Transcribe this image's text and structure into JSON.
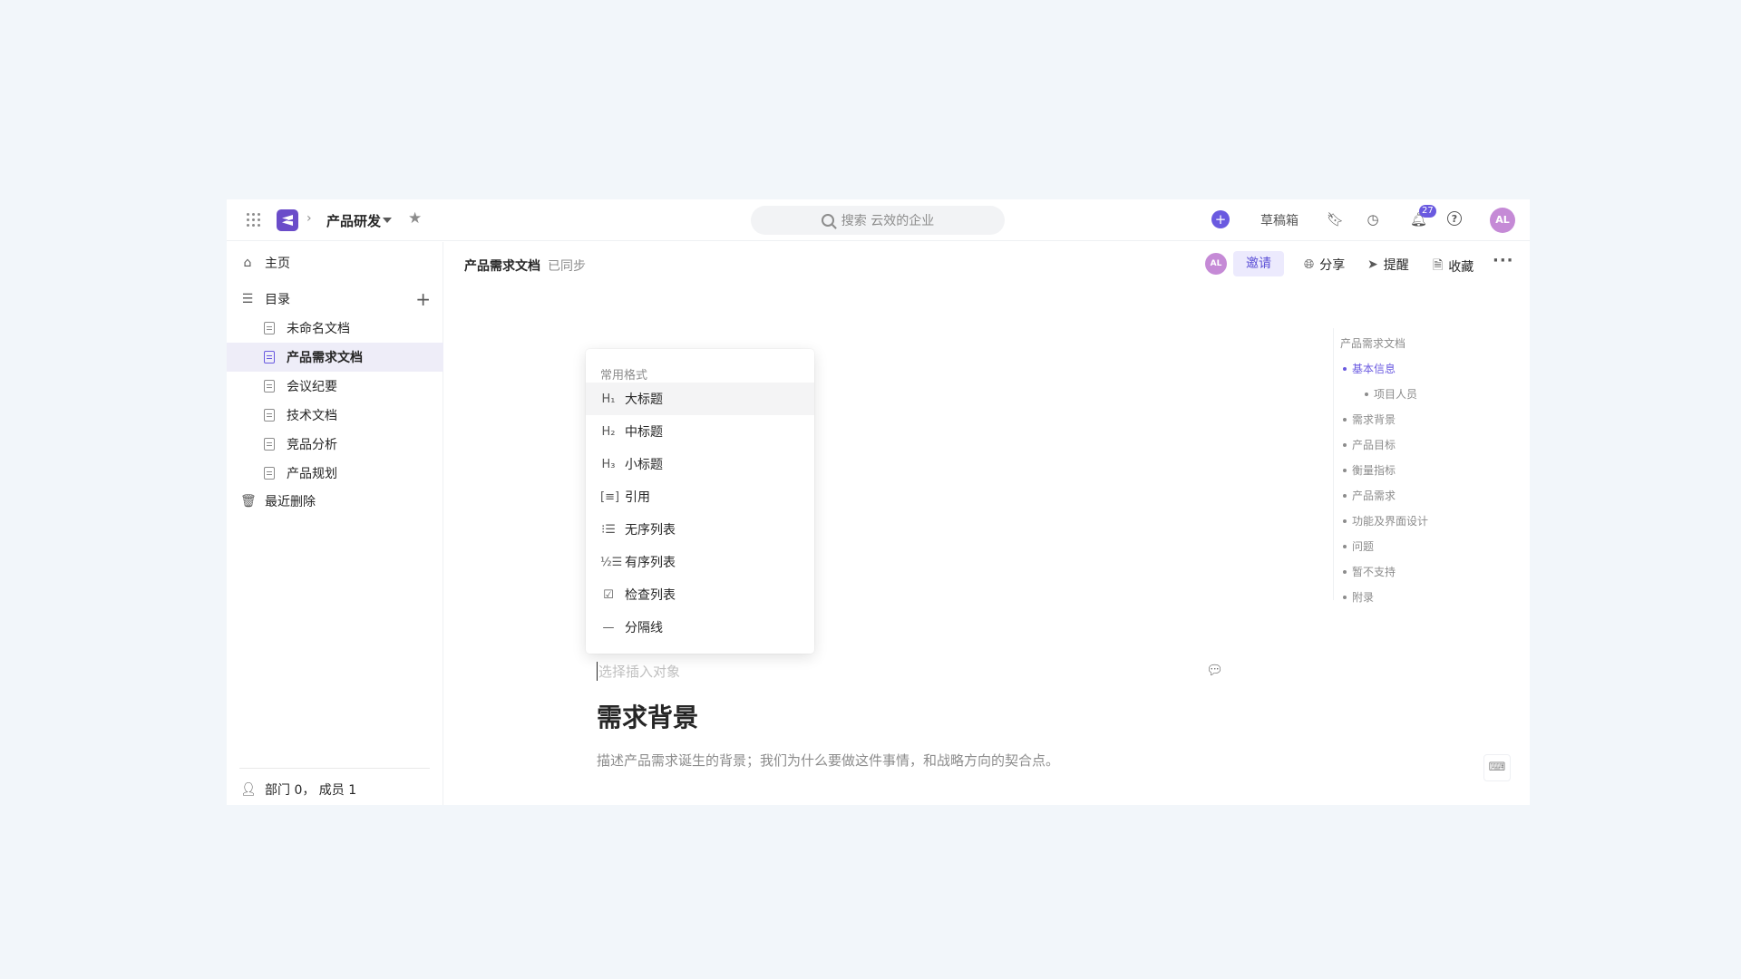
{
  "topbar": {
    "space_name": "产品研发",
    "search_placeholder": "搜索 云效的企业",
    "drafts_label": "草稿箱",
    "notification_count": "27",
    "avatar_initials": "AL",
    "colors": {
      "brand": "#6a4cc9",
      "accent": "#6a5ae0",
      "avatar": "#c58ad6"
    }
  },
  "sidebar": {
    "home_label": "主页",
    "catalog_label": "目录",
    "docs": [
      {
        "label": "未命名文档"
      },
      {
        "label": "产品需求文档"
      },
      {
        "label": "会议纪要"
      },
      {
        "label": "技术文档"
      },
      {
        "label": "竞品分析"
      },
      {
        "label": "产品规划"
      }
    ],
    "trash_label": "最近删除",
    "members_label": "部门 0， 成员 1"
  },
  "doc_header": {
    "title": "产品需求文档",
    "status": "已同步",
    "avatar_initials": "AL",
    "invite_label": "邀请",
    "share_label": "分享",
    "remind_label": "提醒",
    "favorite_label": "收藏"
  },
  "format_menu": {
    "title": "常用格式",
    "items": [
      {
        "icon": "H₁",
        "label": "大标题"
      },
      {
        "icon": "H₂",
        "label": "中标题"
      },
      {
        "icon": "H₃",
        "label": "小标题"
      },
      {
        "icon": "[≡]",
        "label": "引用"
      },
      {
        "icon": "⁝☰",
        "label": "无序列表"
      },
      {
        "icon": "½☰",
        "label": "有序列表"
      },
      {
        "icon": "☑",
        "label": "检查列表"
      },
      {
        "icon": "—",
        "label": "分隔线"
      }
    ]
  },
  "editor": {
    "insert_placeholder": "选择插入对象",
    "section_heading": "需求背景",
    "section_description": "描述产品需求诞生的背景；我们为什么要做这件事情，和战略方向的契合点。"
  },
  "outline": {
    "title": "产品需求文档",
    "items": [
      {
        "label": "基本信息"
      },
      {
        "label": "项目人员"
      },
      {
        "label": "需求背景"
      },
      {
        "label": "产品目标"
      },
      {
        "label": "衡量指标"
      },
      {
        "label": "产品需求"
      },
      {
        "label": "功能及界面设计"
      },
      {
        "label": "问题"
      },
      {
        "label": "暂不支持"
      },
      {
        "label": "附录"
      }
    ]
  }
}
